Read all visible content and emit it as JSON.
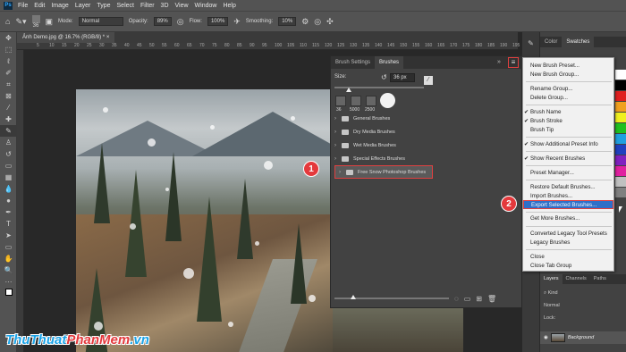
{
  "menubar": {
    "logo": "Ps",
    "items": [
      "File",
      "Edit",
      "Image",
      "Layer",
      "Type",
      "Select",
      "Filter",
      "3D",
      "View",
      "Window",
      "Help"
    ]
  },
  "options": {
    "size_value": "36",
    "mode_label": "Mode:",
    "mode_value": "Normal",
    "opacity_label": "Opacity:",
    "opacity_value": "89%",
    "flow_label": "Flow:",
    "flow_value": "100%",
    "smoothing_label": "Smoothing:",
    "smoothing_value": "10%"
  },
  "document": {
    "tab_title": "Ảnh Demo.jpg @ 16.7% (RGB/8) *",
    "ruler_ticks": [
      "5",
      "10",
      "15",
      "20",
      "25",
      "30",
      "35",
      "40",
      "45",
      "50",
      "55",
      "60",
      "65",
      "70",
      "75",
      "80",
      "85",
      "90",
      "95",
      "100",
      "105",
      "110",
      "115",
      "120",
      "125",
      "130",
      "135",
      "140",
      "145",
      "150",
      "155",
      "160",
      "165",
      "170",
      "175",
      "180",
      "185",
      "190",
      "195"
    ]
  },
  "brush_panel": {
    "tabs": [
      "Brush Settings",
      "Brushes"
    ],
    "collapse_label": "»",
    "menu_icon": "≡",
    "size_label": "Size:",
    "size_value": "36 px",
    "presets": [
      "36",
      "5000",
      "2500"
    ],
    "groups": [
      "General Brushes",
      "Dry Media Brushes",
      "Wet Media Brushes",
      "Special Effects Brushes",
      "Free Snow Photoshop Brushes"
    ]
  },
  "context_menu": {
    "items": [
      {
        "label": "New Brush Preset...",
        "checked": false
      },
      {
        "label": "New Brush Group...",
        "checked": false
      },
      {
        "label": "Rename Group...",
        "checked": false
      },
      {
        "label": "Delete Group...",
        "checked": false
      },
      {
        "label": "Brush Name",
        "checked": true
      },
      {
        "label": "Brush Stroke",
        "checked": true
      },
      {
        "label": "Brush Tip",
        "checked": false
      },
      {
        "label": "Show Additional Preset Info",
        "checked": true
      },
      {
        "label": "Show Recent Brushes",
        "checked": true
      },
      {
        "label": "Preset Manager...",
        "checked": false
      },
      {
        "label": "Restore Default Brushes...",
        "checked": false
      },
      {
        "label": "Import Brushes...",
        "checked": false
      },
      {
        "label": "Export Selected Brushes...",
        "checked": false
      },
      {
        "label": "Get More Brushes...",
        "checked": false
      },
      {
        "label": "Converted Legacy Tool Presets",
        "checked": false
      },
      {
        "label": "Legacy Brushes",
        "checked": false
      },
      {
        "label": "Close",
        "checked": false
      },
      {
        "label": "Close Tab Group",
        "checked": false
      }
    ]
  },
  "right_panel": {
    "tabs": [
      "Color",
      "Swatches"
    ],
    "swatch_colors": [
      "#ffffff",
      "#000000",
      "#e02020",
      "#f0a020",
      "#f0f020",
      "#20c020",
      "#20a0e0",
      "#2040c0",
      "#8020c0",
      "#e020a0",
      "#c0c0c0",
      "#808080"
    ]
  },
  "layers": {
    "tabs": [
      "Layers",
      "Channels",
      "Paths"
    ],
    "kind_label": "Kind",
    "blend_label": "Normal",
    "lock_label": "Lock:",
    "layer_name": "Background"
  },
  "badges": {
    "one": "1",
    "two": "2"
  },
  "watermark": {
    "part1": "ThuThuat",
    "part2": "PhanMem",
    "part3": ".vn"
  }
}
